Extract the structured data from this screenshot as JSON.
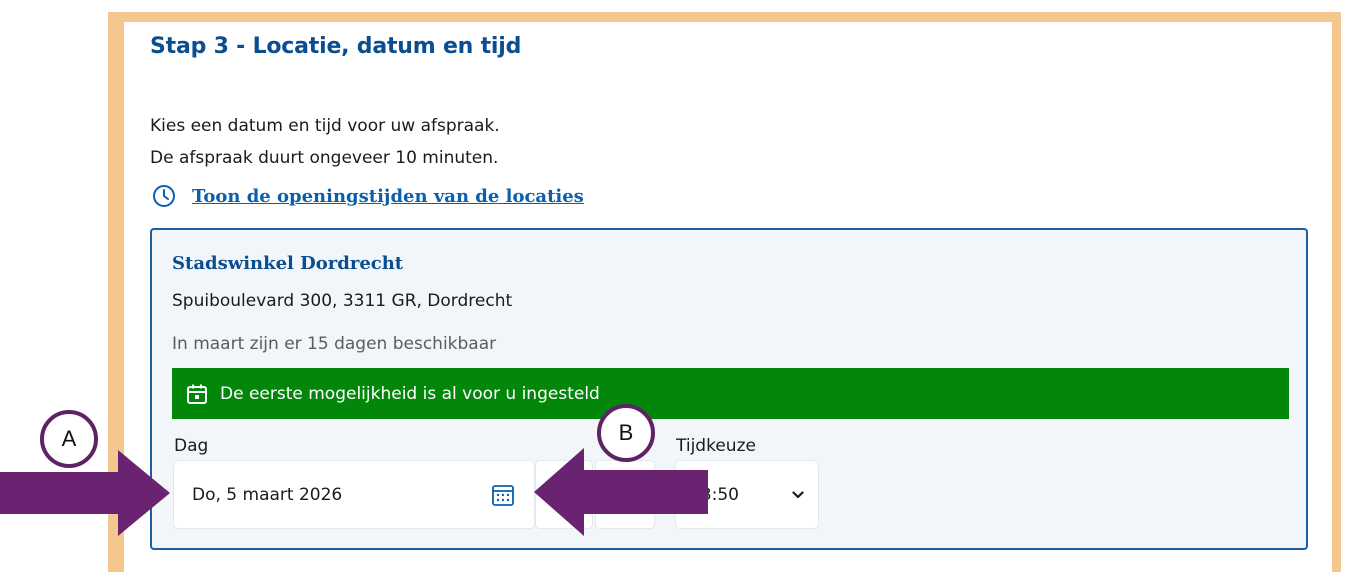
{
  "step": {
    "title": "Stap 3 - Locatie, datum en tijd",
    "intro_line1": "Kies een datum en tijd voor uw afspraak.",
    "intro_line2": "De afspraak duurt ongeveer 10 minuten.",
    "hours_link": "Toon de openingstijden van de locaties"
  },
  "location": {
    "name": "Stadswinkel Dordrecht",
    "address": "Spuiboulevard 300, 3311 GR, Dordrecht",
    "availability": "In maart zijn er 15 dagen beschikbaar",
    "notice": "De eerste mogelijkheid is al voor u ingesteld",
    "day_label": "Dag",
    "day_value": "Do, 5 maart 2026",
    "time_label": "Tijdkeuze",
    "time_value": "13:50"
  },
  "annotations": {
    "marker_a": "A",
    "marker_b": "B"
  },
  "icons": {
    "hours": "clock-icon",
    "notice": "calendar-check-icon",
    "day": "calendar-icon",
    "time": "chevron-down-icon"
  },
  "colors": {
    "frame": "#f4c78f",
    "heading": "#0a4d91",
    "link": "#0a5fae",
    "card_border": "#1b5fa3",
    "card_background": "#f2f6fa",
    "notice_background": "#03870b",
    "annotation": "#5e2364"
  }
}
